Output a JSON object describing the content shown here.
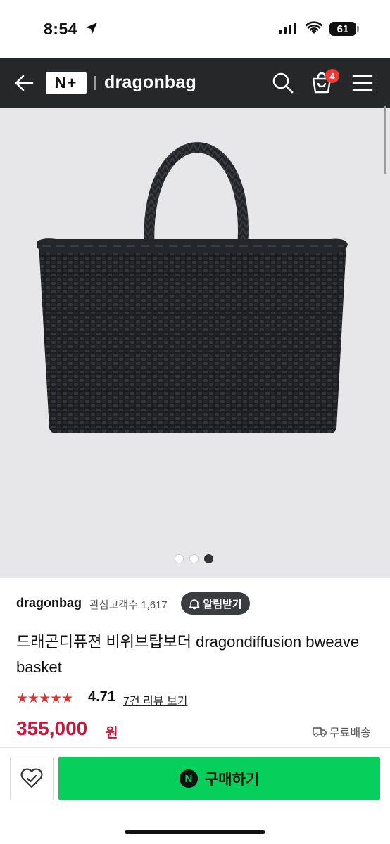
{
  "status_bar": {
    "time": "8:54",
    "battery": "61"
  },
  "header": {
    "logo_text": "N+",
    "brand": "dragonbag",
    "cart_count": "4"
  },
  "gallery": {
    "slides": 3,
    "active_index": 2
  },
  "store": {
    "name": "dragonbag",
    "followers_label": "관심고객수",
    "followers_count": "1,617",
    "notify_label": "알림받기"
  },
  "product": {
    "title": "드래곤디퓨젼 비위브탑보더 dragondiffusion bweave basket",
    "stars": "★★★★★",
    "rating": "4.71",
    "reviews_link": "7건 리뷰 보기",
    "price": "355,000",
    "currency": "원",
    "shipping": "무료배송"
  },
  "actions": {
    "buy_label": "구매하기",
    "n_badge": "N"
  },
  "colors": {
    "appbar": "#252729",
    "price": "#c4193b",
    "buy": "#06cf5c",
    "cart_badge": "#ef3b36"
  }
}
